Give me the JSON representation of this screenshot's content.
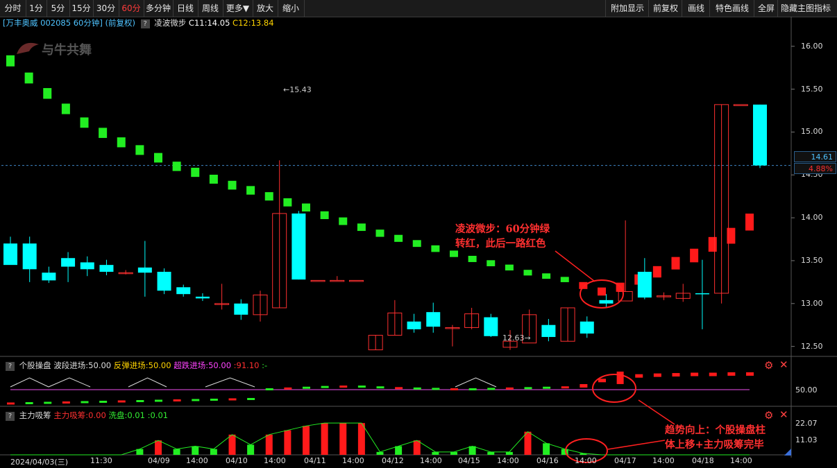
{
  "toolbar": {
    "left": [
      "分时",
      "1分",
      "5分",
      "15分",
      "30分",
      "60分",
      "多分钟",
      "日线",
      "周线",
      "更多▼",
      "放大",
      "缩小"
    ],
    "active": "60分",
    "right": [
      "附加显示",
      "前复权",
      "画线",
      "特色画线",
      "全屏",
      "隐藏主图指标"
    ]
  },
  "info": {
    "stock": "[万丰奥威 002085 60分钟] (前复权)",
    "badge": "?",
    "indicator": "凌波微步",
    "c11": "C11:14.05",
    "c12": "C12:13.84"
  },
  "watermark": "与牛共舞",
  "price_axis": {
    "ticks": [
      "16.00",
      "15.50",
      "15.00",
      "14.50",
      "14.00",
      "13.50",
      "13.00",
      "12.50"
    ],
    "last_price": "14.61",
    "change_pct": "4.88%"
  },
  "main_labels": {
    "high": "←15.43",
    "low": "12.63→"
  },
  "panel2": {
    "badge": "?",
    "name": "个股操盘",
    "p1": "波段进场:50.00",
    "p2": "反弹进场:50.00",
    "p3": "超跌进场:50.00",
    "p4": ":91.10",
    "p5": ":-",
    "axis_label": "50.00"
  },
  "panel3": {
    "badge": "?",
    "name": "主力吸筹",
    "p1": "主力吸筹:0.00",
    "p2": "洗盘:0.01",
    "p3": ":0.01",
    "axis_hi": "22.07",
    "axis_mid": "11.03"
  },
  "x_axis": [
    "2024/04/03(三)",
    "11:30",
    "04/09",
    "14:00",
    "04/10",
    "14:00",
    "04/11",
    "14:00",
    "04/12",
    "14:00",
    "04/15",
    "14:00",
    "04/16",
    "14:00",
    "04/17",
    "14:00",
    "04/18",
    "14:00"
  ],
  "annotations": {
    "a1_line1": "凌波微步：60分钟绿",
    "a1_line2": "转红，此后一路红色",
    "a2_line1": "趋势向上：个股操盘柱",
    "a2_line2": "体上移+主力吸筹完毕"
  },
  "colors": {
    "up": "#ff3030",
    "down": "#00ffff",
    "step_green": "#22ee22",
    "step_red": "#ff1a1a",
    "accent": "#ff3b3b"
  },
  "chart_data": {
    "type": "candlestick",
    "price_range": [
      12.4,
      16.2
    ],
    "candles": [
      [
        13.7,
        13.45,
        13.78,
        13.48
      ],
      [
        13.7,
        13.4,
        13.78,
        13.25
      ],
      [
        13.36,
        13.27,
        13.43,
        13.24
      ],
      [
        13.53,
        13.43,
        13.6,
        13.25
      ],
      [
        13.48,
        13.4,
        13.55,
        13.32
      ],
      [
        13.45,
        13.37,
        13.51,
        13.33
      ],
      [
        13.36,
        13.36,
        13.39,
        13.34
      ],
      [
        13.42,
        13.36,
        13.73,
        13.08
      ],
      [
        13.37,
        13.15,
        13.41,
        13.11
      ],
      [
        13.19,
        13.11,
        13.22,
        13.08
      ],
      [
        13.08,
        13.06,
        13.12,
        13.03
      ],
      [
        13.0,
        13.0,
        13.23,
        12.93
      ],
      [
        13.0,
        12.87,
        13.05,
        12.81
      ],
      [
        12.87,
        13.1,
        13.15,
        12.79
      ],
      [
        12.95,
        14.05,
        14.67,
        12.95
      ],
      [
        14.05,
        13.28,
        14.08,
        13.28
      ],
      [
        13.27,
        13.27,
        13.27,
        13.27
      ],
      [
        13.27,
        13.27,
        13.32,
        13.27
      ],
      [
        13.27,
        13.27,
        13.27,
        13.27
      ],
      [
        12.46,
        12.63,
        12.63,
        12.46
      ],
      [
        12.63,
        12.89,
        13.04,
        12.63
      ],
      [
        12.79,
        12.7,
        12.88,
        12.66
      ],
      [
        12.9,
        12.73,
        13.01,
        12.66
      ],
      [
        12.72,
        12.72,
        12.75,
        12.5
      ],
      [
        12.72,
        12.88,
        12.95,
        12.7
      ],
      [
        12.84,
        12.62,
        12.88,
        12.61
      ],
      [
        12.49,
        12.56,
        12.69,
        12.46
      ],
      [
        12.54,
        12.87,
        12.93,
        12.62
      ],
      [
        12.75,
        12.61,
        12.82,
        12.56
      ],
      [
        12.56,
        12.95,
        12.95,
        12.56
      ],
      [
        12.79,
        12.65,
        12.85,
        12.6
      ],
      [
        13.04,
        13.0,
        13.11,
        12.96
      ],
      [
        13.03,
        13.14,
        13.97,
        13.14
      ],
      [
        13.37,
        13.07,
        13.53,
        13.05
      ],
      [
        13.09,
        13.09,
        13.13,
        13.04
      ],
      [
        13.06,
        13.12,
        13.23,
        13.02
      ],
      [
        13.12,
        13.11,
        13.51,
        12.7
      ],
      [
        13.12,
        15.32,
        15.32,
        13.0
      ],
      [
        15.32,
        15.32,
        15.32,
        15.32
      ],
      [
        15.32,
        14.61,
        15.32,
        14.58
      ]
    ],
    "step_line": {
      "colors": [
        "g",
        "g",
        "g",
        "g",
        "g",
        "g",
        "g",
        "g",
        "g",
        "g",
        "g",
        "g",
        "g",
        "g",
        "g",
        "g",
        "g",
        "g",
        "g",
        "g",
        "g",
        "g",
        "g",
        "g",
        "g",
        "g",
        "g",
        "g",
        "g",
        "g",
        "g",
        "r",
        "r",
        "r",
        "r",
        "r",
        "r",
        "r",
        "r",
        "r",
        "r"
      ],
      "values": [
        15.83,
        15.63,
        15.45,
        15.27,
        15.11,
        14.99,
        14.88,
        14.79,
        14.7,
        14.6,
        14.53,
        14.45,
        14.38,
        14.32,
        14.25,
        14.18,
        14.12,
        14.03,
        13.96,
        13.89,
        13.82,
        13.76,
        13.7,
        13.64,
        13.58,
        13.52,
        13.47,
        13.42,
        13.36,
        13.32,
        13.28,
        13.21,
        13.14,
        13.19,
        13.28,
        13.37,
        13.47,
        13.56,
        13.69,
        13.79,
        13.95
      ]
    },
    "panel2_bars": [
      50,
      50,
      50,
      50,
      50,
      50,
      50,
      50,
      50,
      50,
      50,
      50,
      50,
      50,
      51,
      53,
      55,
      57,
      58,
      58,
      56,
      54,
      53,
      52,
      51,
      51,
      52,
      53,
      54,
      55,
      56,
      60,
      74,
      81,
      86,
      88,
      89,
      90,
      90,
      91,
      91
    ],
    "panel3_bars": [
      0,
      0,
      0,
      0,
      0,
      0,
      0,
      4,
      10,
      4,
      6,
      4,
      14,
      7,
      14,
      17,
      20,
      22,
      22,
      22,
      2,
      6,
      10,
      2,
      2,
      6,
      2,
      2,
      16,
      8,
      4,
      1,
      0,
      0,
      0,
      0,
      0,
      0,
      0,
      0,
      0
    ]
  }
}
